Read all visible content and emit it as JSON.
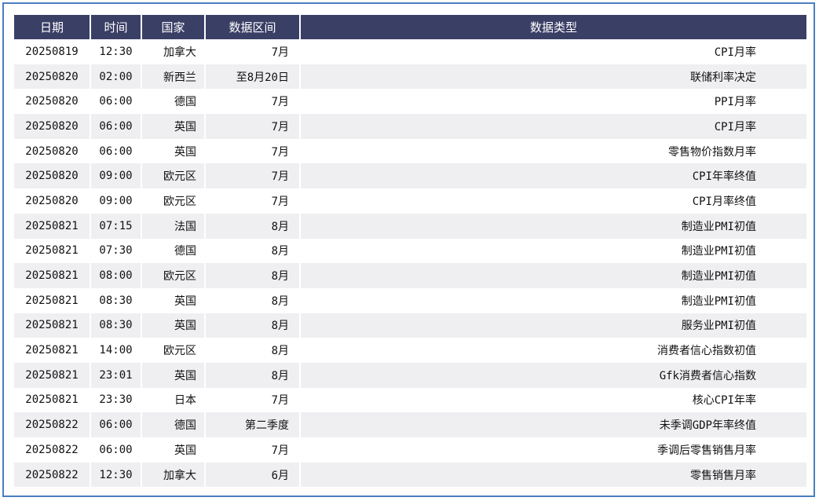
{
  "headers": [
    "日期",
    "时间",
    "国家",
    "数据区间",
    "数据类型"
  ],
  "rows": [
    {
      "date": "20250819",
      "time": "12:30",
      "country": "加拿大",
      "period": "7月",
      "type": "CPI月率"
    },
    {
      "date": "20250820",
      "time": "02:00",
      "country": "新西兰",
      "period": "至8月20日",
      "type": "联储利率决定"
    },
    {
      "date": "20250820",
      "time": "06:00",
      "country": "德国",
      "period": "7月",
      "type": "PPI月率"
    },
    {
      "date": "20250820",
      "time": "06:00",
      "country": "英国",
      "period": "7月",
      "type": "CPI月率"
    },
    {
      "date": "20250820",
      "time": "06:00",
      "country": "英国",
      "period": "7月",
      "type": "零售物价指数月率"
    },
    {
      "date": "20250820",
      "time": "09:00",
      "country": "欧元区",
      "period": "7月",
      "type": "CPI年率终值"
    },
    {
      "date": "20250820",
      "time": "09:00",
      "country": "欧元区",
      "period": "7月",
      "type": "CPI月率终值"
    },
    {
      "date": "20250821",
      "time": "07:15",
      "country": "法国",
      "period": "8月",
      "type": "制造业PMI初值"
    },
    {
      "date": "20250821",
      "time": "07:30",
      "country": "德国",
      "period": "8月",
      "type": "制造业PMI初值"
    },
    {
      "date": "20250821",
      "time": "08:00",
      "country": "欧元区",
      "period": "8月",
      "type": "制造业PMI初值"
    },
    {
      "date": "20250821",
      "time": "08:30",
      "country": "英国",
      "period": "8月",
      "type": "制造业PMI初值"
    },
    {
      "date": "20250821",
      "time": "08:30",
      "country": "英国",
      "period": "8月",
      "type": "服务业PMI初值"
    },
    {
      "date": "20250821",
      "time": "14:00",
      "country": "欧元区",
      "period": "8月",
      "type": "消费者信心指数初值"
    },
    {
      "date": "20250821",
      "time": "23:01",
      "country": "英国",
      "period": "8月",
      "type": "Gfk消费者信心指数"
    },
    {
      "date": "20250821",
      "time": "23:30",
      "country": "日本",
      "period": "7月",
      "type": "核心CPI年率"
    },
    {
      "date": "20250822",
      "time": "06:00",
      "country": "德国",
      "period": "第二季度",
      "type": "未季调GDP年率终值"
    },
    {
      "date": "20250822",
      "time": "06:00",
      "country": "英国",
      "period": "7月",
      "type": "季调后零售销售月率"
    },
    {
      "date": "20250822",
      "time": "12:30",
      "country": "加拿大",
      "period": "6月",
      "type": "零售销售月率"
    }
  ],
  "colors": {
    "header_bg": "#3a3f66",
    "frame_border": "#4a7ec2",
    "stripe": "#efeff2"
  }
}
